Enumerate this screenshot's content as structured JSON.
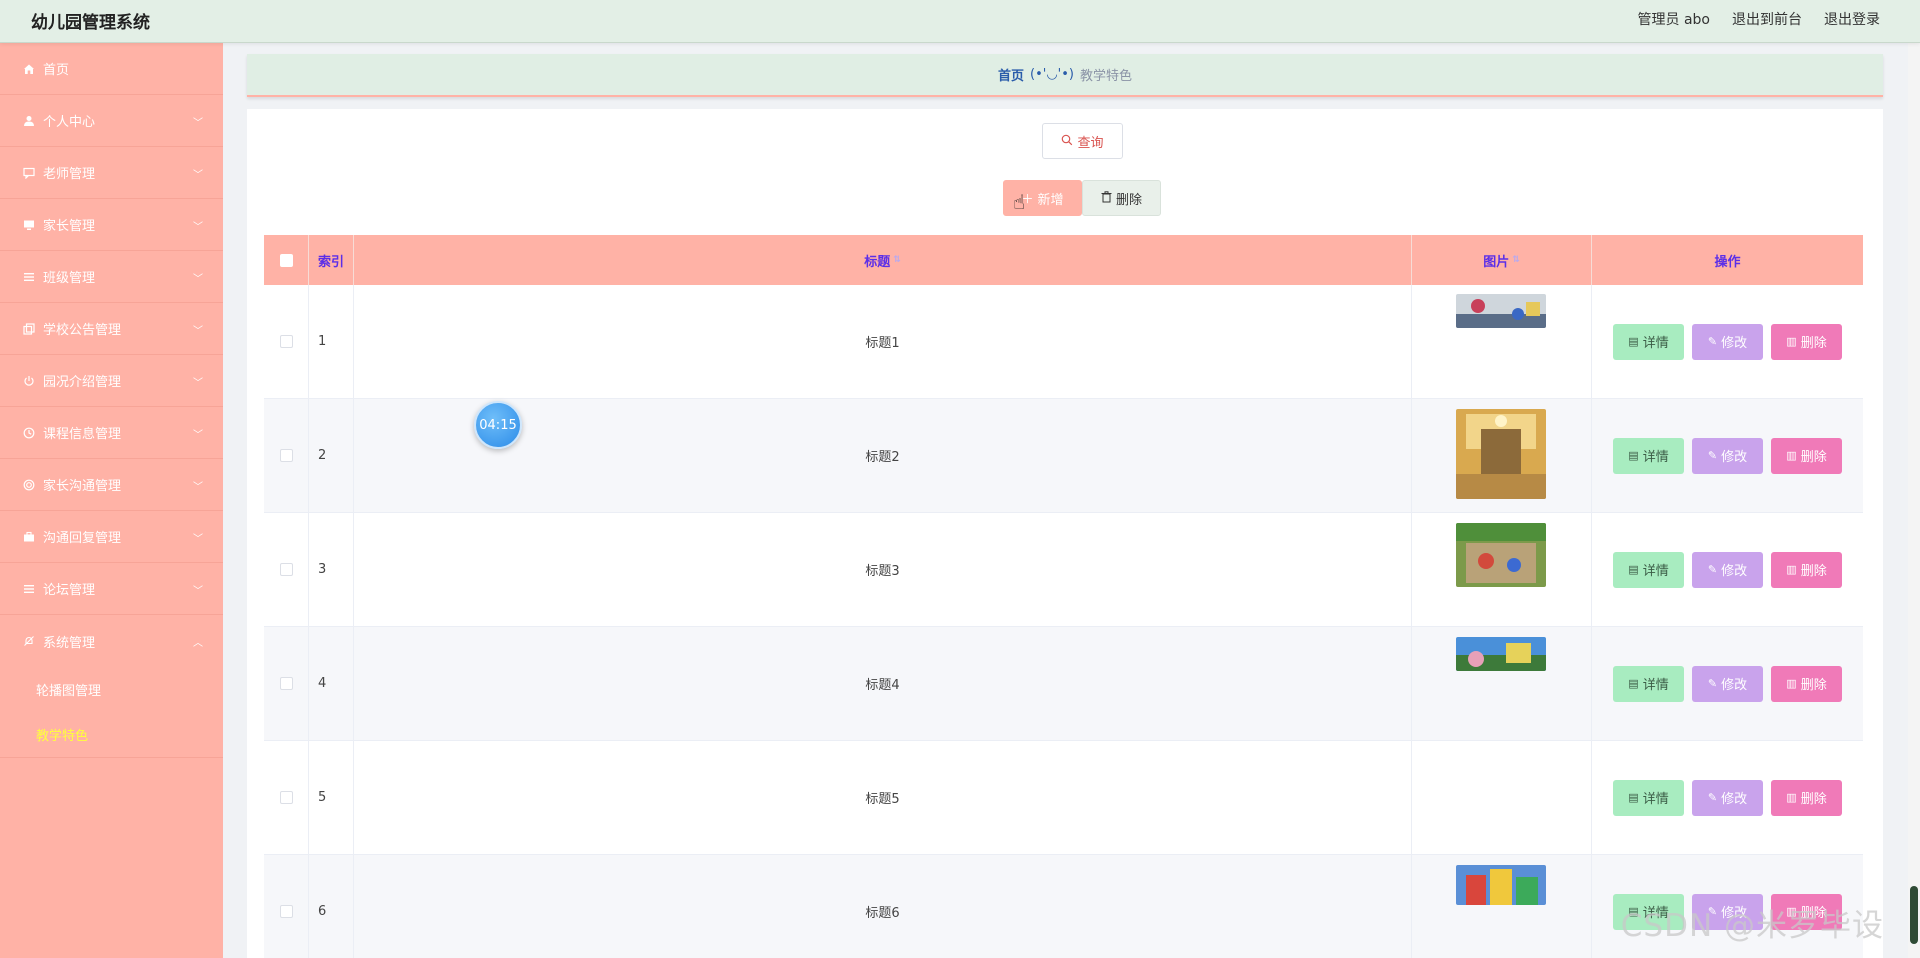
{
  "app": {
    "title": "幼儿园管理系统"
  },
  "header": {
    "user_label": "管理员 abo",
    "front_label": "退出到前台",
    "logout_label": "退出登录"
  },
  "sidebar": {
    "items": [
      {
        "label": "首页",
        "icon": "home-icon"
      },
      {
        "label": "个人中心",
        "icon": "user-icon"
      },
      {
        "label": "老师管理",
        "icon": "message-icon"
      },
      {
        "label": "家长管理",
        "icon": "monitor-icon"
      },
      {
        "label": "班级管理",
        "icon": "list-icon"
      },
      {
        "label": "学校公告管理",
        "icon": "copy-icon"
      },
      {
        "label": "园况介绍管理",
        "icon": "power-icon"
      },
      {
        "label": "课程信息管理",
        "icon": "clock-icon"
      },
      {
        "label": "家长沟通管理",
        "icon": "ring-icon"
      },
      {
        "label": "沟通回复管理",
        "icon": "briefcase-icon"
      },
      {
        "label": "论坛管理",
        "icon": "list-icon"
      },
      {
        "label": "系统管理",
        "icon": "bell-off-icon"
      }
    ],
    "sub_items": [
      {
        "label": "轮播图管理"
      },
      {
        "label": "教学特色"
      }
    ]
  },
  "breadcrumb": {
    "home": "首页",
    "face": "(•'◡'•)",
    "current": "教学特色"
  },
  "toolbar": {
    "query_label": "查询",
    "add_label": "新增",
    "delete_label": "删除"
  },
  "table": {
    "headers": {
      "index": "索引",
      "title": "标题",
      "image": "图片",
      "actions": "操作"
    },
    "rows": [
      {
        "index": "1",
        "title": "标题1"
      },
      {
        "index": "2",
        "title": "标题2"
      },
      {
        "index": "3",
        "title": "标题3"
      },
      {
        "index": "4",
        "title": "标题4"
      },
      {
        "index": "5",
        "title": "标题5"
      },
      {
        "index": "6",
        "title": "标题6"
      }
    ],
    "actions": {
      "detail": "详情",
      "edit": "修改",
      "remove": "删除"
    }
  },
  "timer": {
    "value": "04:15"
  },
  "watermark": {
    "text": "CSDN @米罗毕设"
  },
  "colors": {
    "accent": "#ffb2a6",
    "header_text": "#5c2fe8",
    "detail": "#a8ecc0",
    "edit": "#c9a3ec",
    "remove": "#f07ab8"
  }
}
